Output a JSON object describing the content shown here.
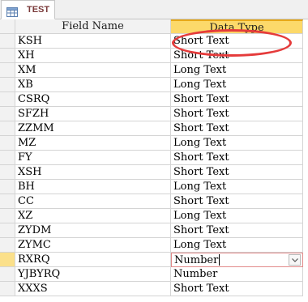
{
  "tab": {
    "label": "TEST",
    "icon": "table-icon"
  },
  "columns": {
    "field_name": "Field Name",
    "data_type": "Data Type"
  },
  "rows": [
    {
      "field": "KSH",
      "type": "Short Text"
    },
    {
      "field": "XH",
      "type": "Short Text"
    },
    {
      "field": "XM",
      "type": "Long Text"
    },
    {
      "field": "XB",
      "type": "Long Text"
    },
    {
      "field": "CSRQ",
      "type": "Short Text"
    },
    {
      "field": "SFZH",
      "type": "Short Text"
    },
    {
      "field": "ZZMM",
      "type": "Short Text"
    },
    {
      "field": "MZ",
      "type": "Long Text"
    },
    {
      "field": "FY",
      "type": "Short Text"
    },
    {
      "field": "XSH",
      "type": "Short Text"
    },
    {
      "field": "BH",
      "type": "Long Text"
    },
    {
      "field": "CC",
      "type": "Short Text"
    },
    {
      "field": "XZ",
      "type": "Long Text"
    },
    {
      "field": "ZYDM",
      "type": "Short Text"
    },
    {
      "field": "ZYMC",
      "type": "Long Text"
    },
    {
      "field": "RXRQ",
      "type": "Number"
    },
    {
      "field": "YJBYRQ",
      "type": "Number"
    },
    {
      "field": "XXXS",
      "type": "Short Text"
    }
  ],
  "current_row_index": 15,
  "colors": {
    "header_bg": "#f2f2f2",
    "selected_header_bg": "#fcd96a",
    "annotation_circle": "#e53b3b",
    "tab_text": "#7a3a3a",
    "current_cell_border": "#e28a8a"
  }
}
